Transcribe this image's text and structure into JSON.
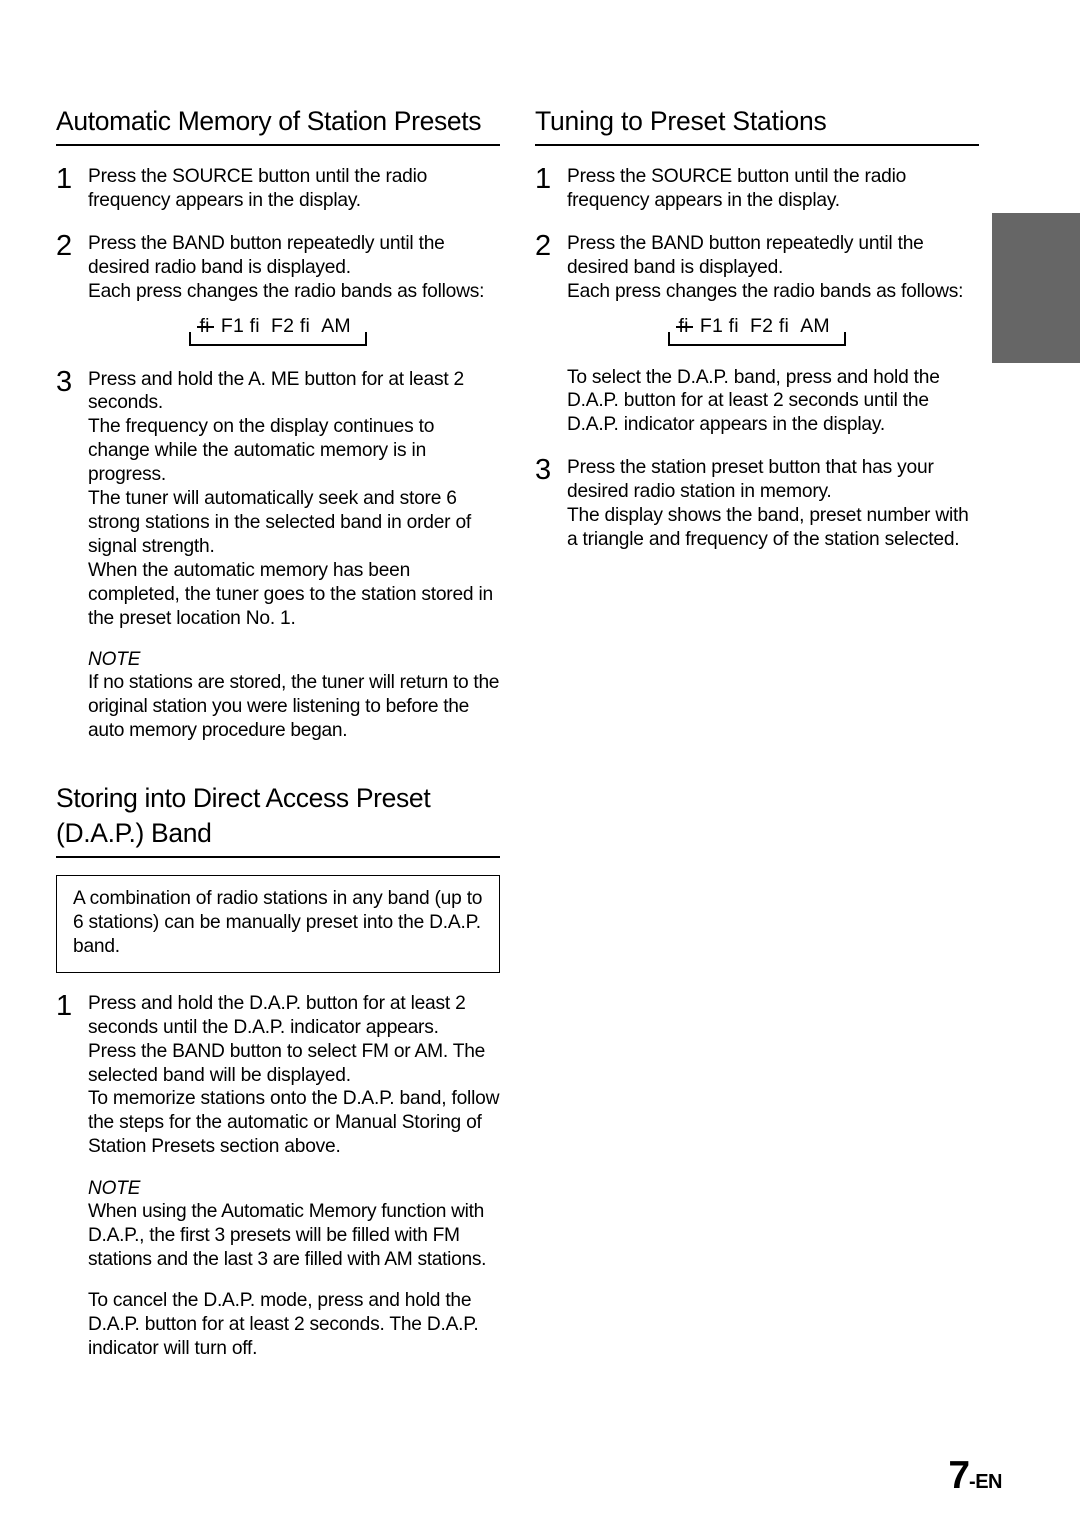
{
  "page": {
    "number": "7",
    "suffix": "-EN"
  },
  "side_tab": {
    "color": "#666666"
  },
  "band_diagram": {
    "arrow_glyph": "fi",
    "bands": [
      "F1",
      "F2",
      "AM"
    ],
    "sequence_text": "fi  F1 fi  F2 fi  AM"
  },
  "left_column": {
    "section1": {
      "heading": "Automatic Memory of Station Presets",
      "steps": [
        {
          "number": "1",
          "lines": [
            "Press the SOURCE button until the radio frequency appears in the display."
          ]
        },
        {
          "number": "2",
          "lines": [
            "Press the BAND button repeatedly until the desired radio band is displayed.",
            "Each press changes the radio bands as follows:"
          ]
        },
        {
          "number": "3",
          "lines": [
            "Press and hold the A. ME button for at least 2 seconds.",
            "The frequency on the display continues to change while the automatic memory is in progress.",
            "The tuner will automatically seek and store 6 strong stations in the selected band in order of signal strength.",
            "When the automatic memory has been completed, the tuner goes to the station stored in the preset location No. 1."
          ]
        }
      ],
      "note": {
        "label": "NOTE",
        "text": "If no stations are stored, the tuner will return to the original station you were listening to before the auto memory procedure began."
      }
    },
    "section2": {
      "heading": "Storing into Direct Access Preset (D.A.P.) Band",
      "callout": "A combination of radio stations in any band (up to 6 stations) can be manually preset into the D.A.P. band.",
      "steps": [
        {
          "number": "1",
          "lines": [
            "Press and hold the D.A.P. button for at least 2 seconds until the D.A.P. indicator appears.",
            "Press the BAND button to select FM or AM. The selected band will be displayed.",
            "To memorize stations onto the D.A.P. band, follow the steps for the automatic or Manual Storing of Station Presets section above."
          ]
        }
      ],
      "note": {
        "label": "NOTE",
        "text": "When using the Automatic Memory function with D.A.P., the first 3 presets will be filled with FM stations and the last 3 are filled with AM stations."
      },
      "closing": "To cancel the D.A.P. mode, press and hold the D.A.P. button for at least 2 seconds. The D.A.P. indicator will turn off."
    }
  },
  "right_column": {
    "section1": {
      "heading": "Tuning to Preset Stations",
      "steps": [
        {
          "number": "1",
          "lines": [
            "Press the SOURCE button until the radio frequency appears in the display."
          ]
        },
        {
          "number": "2",
          "lines": [
            "Press the BAND button repeatedly until the desired band is displayed.",
            "Each press changes the radio bands as follows:"
          ]
        }
      ],
      "after_diagram": "To select the D.A.P. band, press and hold the D.A.P. button for at least 2 seconds until the D.A.P. indicator appears in the display.",
      "step3": {
        "number": "3",
        "lines": [
          "Press the station preset  button that has your desired radio station in memory.",
          "The display shows the band, preset number with a triangle and frequency of the station selected."
        ]
      }
    }
  }
}
